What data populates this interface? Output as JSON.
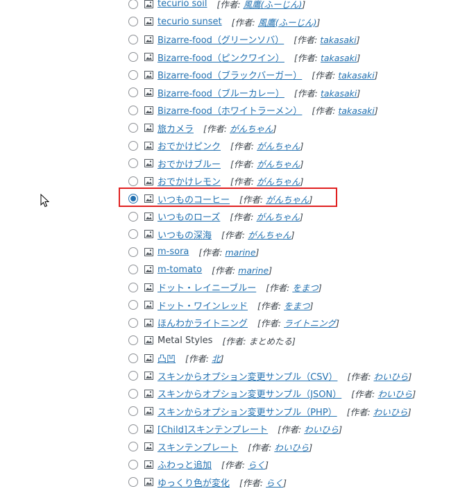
{
  "author_prefix": "[作者:",
  "author_suffix": "]",
  "skins": [
    {
      "name": "tecurio soil",
      "author": "風鷹(ふーじん)",
      "linked": true,
      "checked": false
    },
    {
      "name": "tecurio sunset",
      "author": "風鷹(ふーじん)",
      "linked": true,
      "checked": false
    },
    {
      "name": "Bizarre-food（グリーンソバ）",
      "author": "takasaki",
      "linked": true,
      "checked": false
    },
    {
      "name": "Bizarre-food（ピンクワイン）",
      "author": "takasaki",
      "linked": true,
      "checked": false
    },
    {
      "name": "Bizarre-food（ブラックバーガー）",
      "author": "takasaki",
      "linked": true,
      "checked": false
    },
    {
      "name": "Bizarre-food（ブルーカレー）",
      "author": "takasaki",
      "linked": true,
      "checked": false
    },
    {
      "name": "Bizarre-food（ホワイトラーメン）",
      "author": "takasaki",
      "linked": true,
      "checked": false
    },
    {
      "name": "旅カメラ",
      "author": "がんちゃん",
      "linked": true,
      "checked": false
    },
    {
      "name": "おでかけピンク",
      "author": "がんちゃん",
      "linked": true,
      "checked": false
    },
    {
      "name": "おでかけブルー",
      "author": "がんちゃん",
      "linked": true,
      "checked": false
    },
    {
      "name": "おでかけレモン",
      "author": "がんちゃん",
      "linked": true,
      "checked": false
    },
    {
      "name": "いつものコーヒー",
      "author": "がんちゃん",
      "linked": true,
      "checked": true
    },
    {
      "name": "いつものローズ",
      "author": "がんちゃん",
      "linked": true,
      "checked": false
    },
    {
      "name": "いつもの深海",
      "author": "がんちゃん",
      "linked": true,
      "checked": false
    },
    {
      "name": "m-sora",
      "author": "marine",
      "linked": true,
      "checked": false
    },
    {
      "name": "m-tomato",
      "author": "marine",
      "linked": true,
      "checked": false
    },
    {
      "name": "ドット・レイニーブルー",
      "author": "をまつ",
      "linked": true,
      "checked": false
    },
    {
      "name": "ドット・ワインレッド",
      "author": "をまつ",
      "linked": true,
      "checked": false
    },
    {
      "name": "ほんわかライトニング",
      "author": "ライトニング",
      "linked": true,
      "checked": false
    },
    {
      "name": "Metal Styles",
      "author": "まとめたる",
      "linked": false,
      "checked": false
    },
    {
      "name": "凸凹",
      "author": "北",
      "linked": true,
      "checked": false
    },
    {
      "name": "スキンからオプション変更サンプル（CSV）",
      "author": "わいひら",
      "linked": true,
      "checked": false
    },
    {
      "name": "スキンからオプション変更サンプル（JSON）",
      "author": "わいひら",
      "linked": true,
      "checked": false
    },
    {
      "name": "スキンからオプション変更サンプル（PHP）",
      "author": "わいひら",
      "linked": true,
      "checked": false
    },
    {
      "name": "[Child]スキンテンプレート",
      "author": "わいひら",
      "linked": true,
      "checked": false
    },
    {
      "name": "スキンテンプレート",
      "author": "わいひら",
      "linked": true,
      "checked": false
    },
    {
      "name": "ふわっと追加",
      "author": "らく",
      "linked": true,
      "checked": false
    },
    {
      "name": "ゆっくり色が変化",
      "author": "らく",
      "linked": true,
      "checked": false
    }
  ],
  "colors": {
    "link": "#2271b1",
    "text": "#3c434a",
    "highlight_border": "#e02020",
    "radio_border": "#8c8f94"
  },
  "icons": {
    "row_icon": "image-icon",
    "pointer": "mouse-cursor-icon"
  }
}
